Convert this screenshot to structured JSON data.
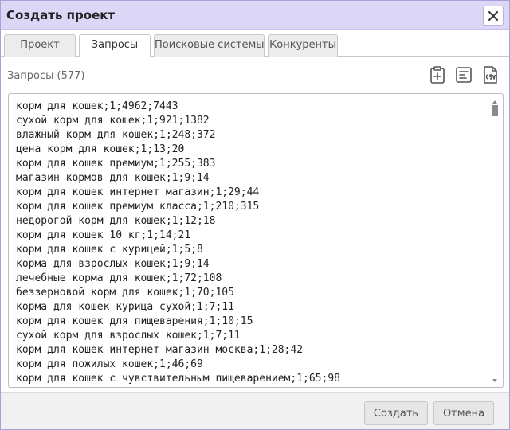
{
  "dialog": {
    "title": "Создать проект",
    "close_icon": "close-icon"
  },
  "tabs": [
    {
      "label": "Проект",
      "active": false
    },
    {
      "label": "Запросы",
      "active": true
    },
    {
      "label": "Поисковые системы",
      "active": false
    },
    {
      "label": "Конкуренты",
      "active": false
    }
  ],
  "queries": {
    "label": "Запросы (577)",
    "toolbar": {
      "paste_icon": "clipboard-plus-icon",
      "format_icon": "list-format-icon",
      "csv_icon": "csv-file-icon"
    },
    "lines": [
      "корм для кошек;1;4962;7443",
      "сухой корм для кошек;1;921;1382",
      "влажный корм для кошек;1;248;372",
      "цена корм для кошек;1;13;20",
      "корм для кошек премиум;1;255;383",
      "магазин кормов для кошек;1;9;14",
      "корм для кошек интернет магазин;1;29;44",
      "корм для кошек премиум класса;1;210;315",
      "недорогой корм для кошек;1;12;18",
      "корм для кошек 10 кг;1;14;21",
      "корм для кошек с курицей;1;5;8",
      "корма для взрослых кошек;1;9;14",
      "лечебные корма для кошек;1;72;108",
      "беззерновой корм для кошек;1;70;105",
      "корма для кошек курица сухой;1;7;11",
      "корм для кошек для пищеварения;1;10;15",
      "сухой корм для взрослых кошек;1;7;11",
      "корм для кошек интернет магазин москва;1;28;42",
      "корм для пожилых кошек;1;46;69",
      "корм для кошек с чувствительным пищеварением;1;65;98"
    ]
  },
  "footer": {
    "create_label": "Создать",
    "cancel_label": "Отмена"
  },
  "colors": {
    "titlebar": "#dcd6f7",
    "border": "#a7a1d8",
    "icon": "#555555"
  }
}
